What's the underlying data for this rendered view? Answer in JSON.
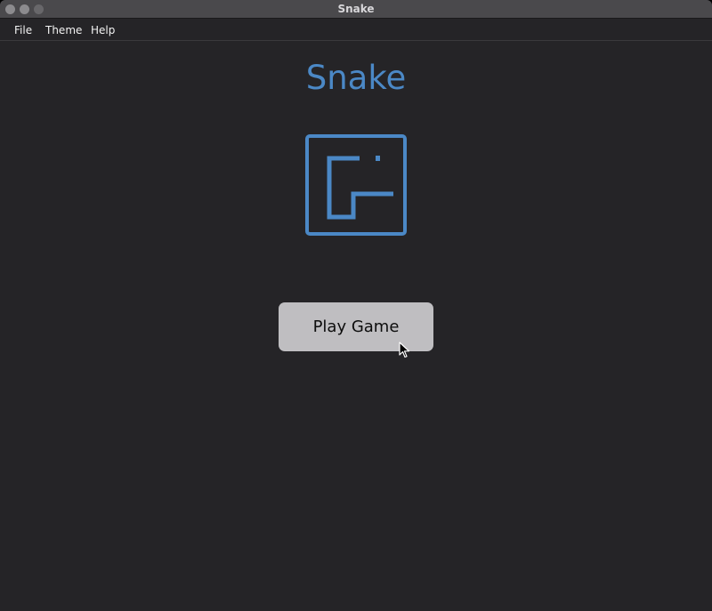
{
  "window": {
    "title": "Snake"
  },
  "menu": {
    "items": [
      "File",
      "Theme",
      "Help"
    ]
  },
  "game": {
    "title": "Snake",
    "play_label": "Play Game",
    "logo_icon": "snake-logo-icon"
  },
  "colors": {
    "background": "#252427",
    "accent": "#4b88c6",
    "button": "#bfbec1"
  }
}
